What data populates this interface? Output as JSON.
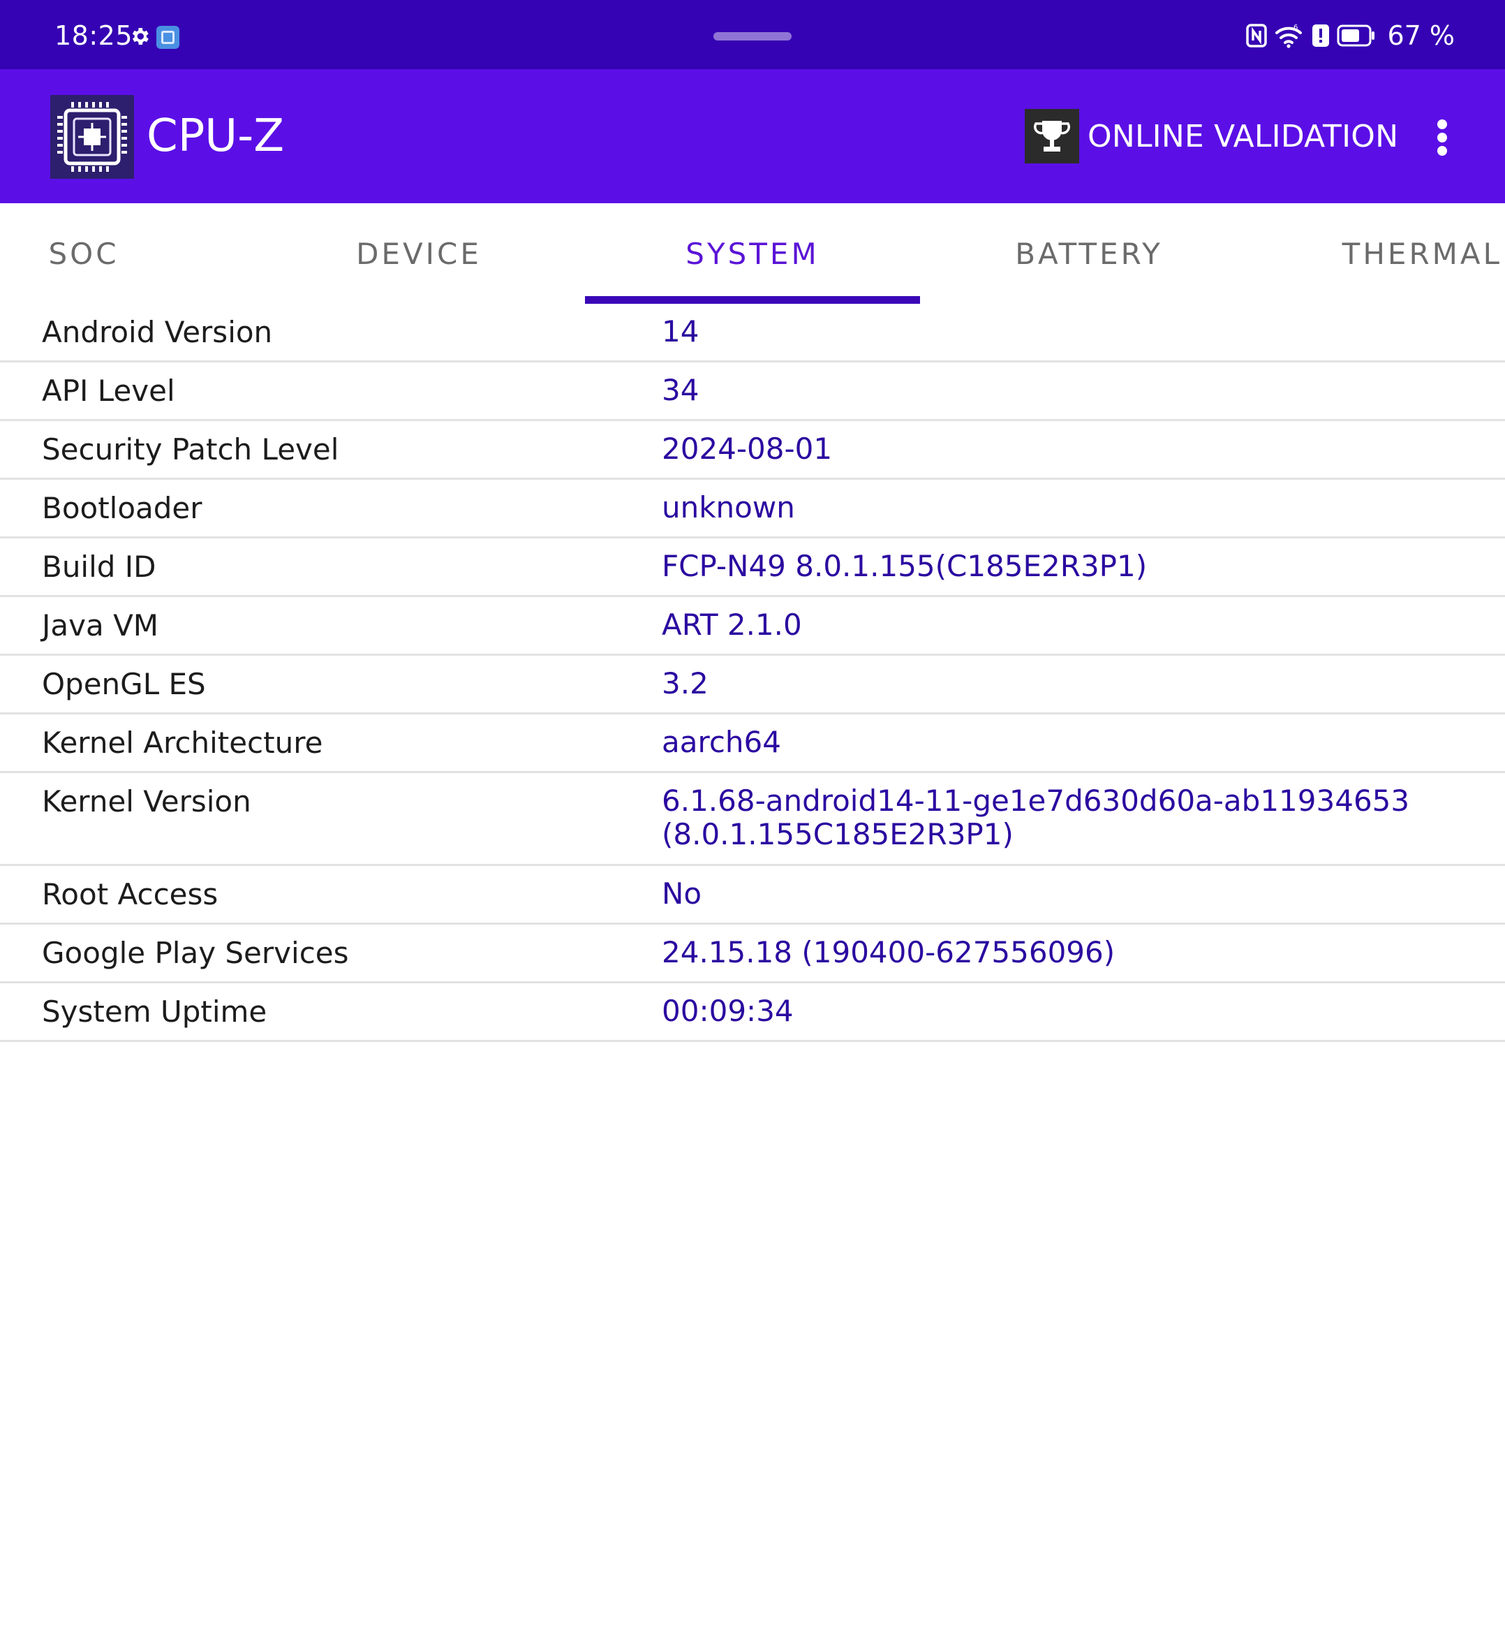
{
  "status_bar": {
    "time": "18:25",
    "battery": "67 %"
  },
  "app_bar": {
    "title": "CPU-Z",
    "validation_label": "ONLINE VALIDATION"
  },
  "tabs": [
    {
      "label": "SOC"
    },
    {
      "label": "DEVICE"
    },
    {
      "label": "SYSTEM"
    },
    {
      "label": "BATTERY"
    },
    {
      "label": "THERMAL"
    }
  ],
  "active_tab": "SYSTEM",
  "system_rows": [
    {
      "label": "Android Version",
      "value": "14"
    },
    {
      "label": "API Level",
      "value": "34"
    },
    {
      "label": "Security Patch Level",
      "value": "2024-08-01"
    },
    {
      "label": "Bootloader",
      "value": "unknown"
    },
    {
      "label": "Build ID",
      "value": "FCP-N49 8.0.1.155(C185E2R3P1)"
    },
    {
      "label": "Java VM",
      "value": "ART 2.1.0"
    },
    {
      "label": "OpenGL ES",
      "value": "3.2"
    },
    {
      "label": "Kernel Architecture",
      "value": "aarch64"
    },
    {
      "label": "Kernel Version",
      "value": "6.1.68-android14-11-ge1e7d630d60a-ab11934653\n(8.0.1.155C185E2R3P1)"
    },
    {
      "label": "Root Access",
      "value": "No"
    },
    {
      "label": "Google Play Services",
      "value": "24.15.18 (190400-627556096)"
    },
    {
      "label": "System Uptime",
      "value": "00:09:34"
    }
  ],
  "colors": {
    "status_bar": "#3503b3",
    "app_bar": "#5b0fe6",
    "accent": "#5a14d6",
    "value_text": "#2b0aa0"
  }
}
